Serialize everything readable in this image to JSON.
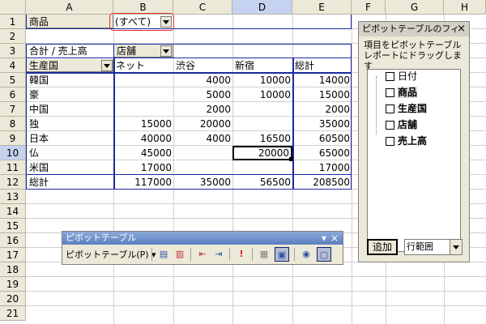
{
  "columns": [
    "A",
    "B",
    "C",
    "D",
    "E",
    "F",
    "G",
    "H"
  ],
  "rows": [
    "1",
    "2",
    "3",
    "4",
    "5",
    "6",
    "7",
    "8",
    "9",
    "10",
    "11",
    "12",
    "13",
    "14",
    "15",
    "16",
    "17",
    "18",
    "19",
    "20",
    "21"
  ],
  "page_field": {
    "label": "商品",
    "value": "(すべて)"
  },
  "data_header": "合計 / 売上高",
  "column_field": "店舗",
  "row_field": "生産国",
  "col_headers": [
    "ネット",
    "渋谷",
    "新宿",
    "総計"
  ],
  "table_rows": [
    {
      "label": "韓国",
      "v": [
        "",
        "4000",
        "10000",
        "14000"
      ]
    },
    {
      "label": "豪",
      "v": [
        "",
        "5000",
        "10000",
        "15000"
      ]
    },
    {
      "label": "中国",
      "v": [
        "",
        "2000",
        "",
        "2000"
      ]
    },
    {
      "label": "独",
      "v": [
        "15000",
        "20000",
        "",
        "35000"
      ]
    },
    {
      "label": "日本",
      "v": [
        "40000",
        "4000",
        "16500",
        "60500"
      ]
    },
    {
      "label": "仏",
      "v": [
        "45000",
        "",
        "20000",
        "65000"
      ]
    },
    {
      "label": "米国",
      "v": [
        "17000",
        "",
        "",
        "17000"
      ]
    },
    {
      "label": "総計",
      "v": [
        "117000",
        "35000",
        "56500",
        "208500"
      ]
    }
  ],
  "field_list": {
    "title": "ピボットテーブルのフィ",
    "close": "×",
    "description": "項目をピボットテーブル レポートにドラッグします",
    "fields": [
      "日付",
      "商品",
      "生産国",
      "店舗",
      "売上高"
    ],
    "add_button": "追加",
    "area_select": "行範囲"
  },
  "toolbar": {
    "title": "ピボットテーブル",
    "menu": "ピボットテーブル(P)",
    "close": "×",
    "dropdown_arrow": "▾"
  }
}
